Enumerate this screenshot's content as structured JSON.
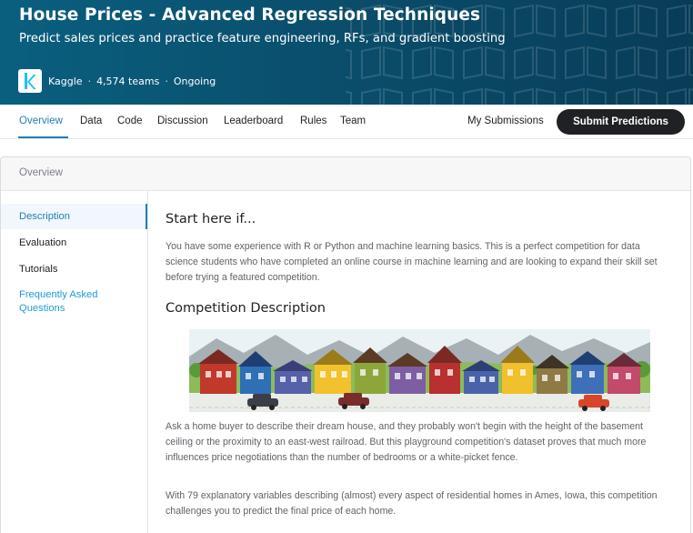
{
  "competition": {
    "title": "House Prices - Advanced Regression Techniques",
    "subtitle": "Predict sales prices and practice feature engineering, RFs, and gradient boosting",
    "host": "Kaggle",
    "teams": "4,574 teams",
    "status": "Ongoing"
  },
  "tabs": [
    {
      "label": "Overview",
      "active": true
    },
    {
      "label": "Data"
    },
    {
      "label": "Code"
    },
    {
      "label": "Discussion"
    },
    {
      "label": "Leaderboard"
    },
    {
      "label": "Rules"
    },
    {
      "label": "Team"
    }
  ],
  "actions": {
    "my_submissions": "My Submissions",
    "submit": "Submit Predictions"
  },
  "section_header": "Overview",
  "sidenav": [
    {
      "label": "Description",
      "active": true
    },
    {
      "label": "Evaluation"
    },
    {
      "label": "Tutorials"
    },
    {
      "label": "Frequently Asked Questions",
      "link": true
    }
  ],
  "content": {
    "start_heading": "Start here if...",
    "start_text": "You have some experience with R or Python and machine learning basics. This is a perfect competition for data science students who have completed an online course in machine learning and are looking to expand their skill set before trying a featured competition.",
    "description_heading": "Competition Description",
    "description_p1": "Ask a home buyer to describe their dream house, and they probably won't begin with the height of the basement ceiling or the proximity to an east-west railroad. But this playground competition's dataset proves that much more influences price negotiations than the number of bedrooms or a white-picket fence.",
    "description_p2": "With 79 explanatory variables describing (almost) every aspect of residential homes in Ames, Iowa, this competition challenges you to predict the final price of each home."
  },
  "colors": {
    "banner": "#0a4f6d",
    "accent": "#1f7fb8",
    "link": "#1f9ad6",
    "button_bg": "#202124"
  },
  "icons": {
    "host_logo": "kaggle-k-logo",
    "banner_pattern": "book-pattern"
  }
}
